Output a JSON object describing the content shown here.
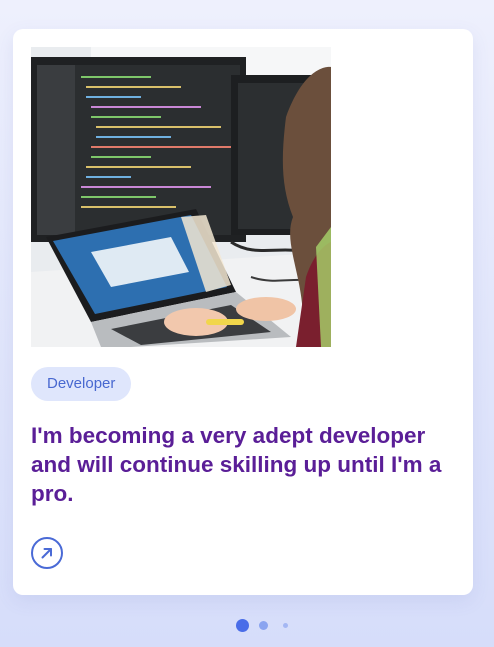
{
  "card": {
    "image_alt": "Person typing on a laptop in front of monitors displaying code",
    "tag_label": "Developer",
    "title": "I'm becoming a very adept developer and will continue skilling up until I'm a pro."
  },
  "icons": {
    "arrow": "arrow-up-right-icon"
  },
  "colors": {
    "title": "#5a1e97",
    "tag_bg": "#dfe6fc",
    "tag_text": "#4868d0",
    "accent": "#4a6ad6",
    "dot_active": "#4a6de8"
  },
  "carousel": {
    "total_slides": 3,
    "active_index": 0
  }
}
